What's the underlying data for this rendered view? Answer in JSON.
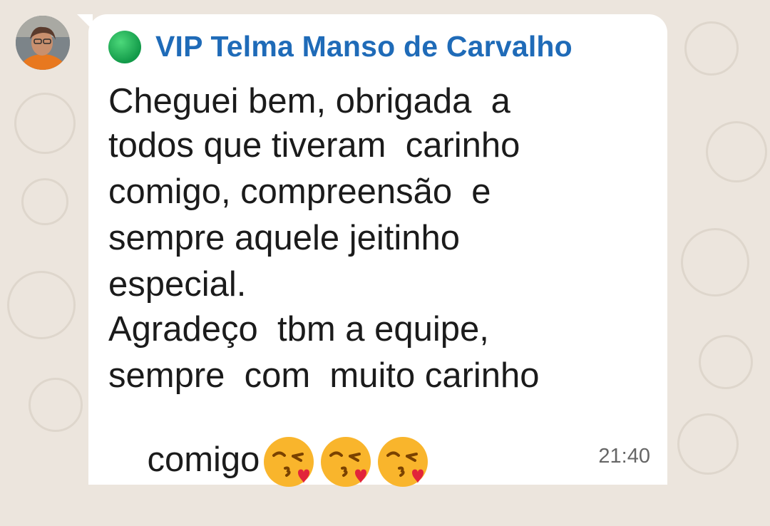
{
  "message": {
    "sender": "VIP Telma Manso de Carvalho",
    "status_indicator_color": "#1aa34a",
    "name_color": "#1f6bb8",
    "lines": [
      "Cheguei bem, obrigada  a",
      "todos que tiveram  carinho",
      "comigo, compreensão  e",
      "sempre aquele jeitinho",
      "especial.",
      "Agradeço  tbm a equipe,",
      "sempre  com  muito carinho",
      "comigo"
    ],
    "emojis": [
      "face-blowing-a-kiss",
      "face-blowing-a-kiss",
      "face-blowing-a-kiss"
    ],
    "time": "21:40"
  }
}
